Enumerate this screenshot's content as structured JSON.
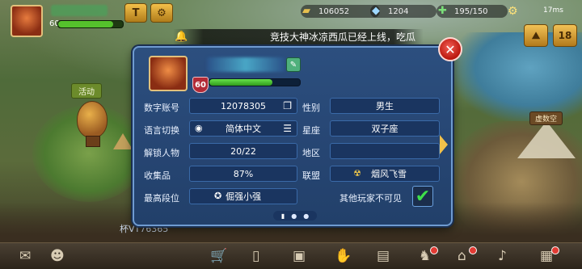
{
  "map": {
    "activity_banner": "活动",
    "location_banner": "虚数空",
    "player_tag": "杯VT76365"
  },
  "hud": {
    "level": "60",
    "exp_fraction": 0.85,
    "resources": [
      {
        "icon": "gold-bar-icon",
        "value": "106052"
      },
      {
        "icon": "gem-icon",
        "value": "1204"
      },
      {
        "icon": "stamina-icon",
        "value": "195/150"
      }
    ],
    "network": "17ms"
  },
  "announcement": {
    "text": "竞技大神冰凉西瓜已经上线，吃瓜"
  },
  "dialog": {
    "level": "60",
    "exp_fraction": 0.7,
    "close_label": "✕",
    "rows": {
      "account_label": "数字账号",
      "account_value": "12078305",
      "gender_label": "性别",
      "gender_value": "男生",
      "language_label": "语言切换",
      "language_value": "简体中文",
      "zodiac_label": "星座",
      "zodiac_value": "双子座",
      "unlock_label": "解锁人物",
      "unlock_value": "20/22",
      "region_label": "地区",
      "region_value": "",
      "collect_label": "收集品",
      "collect_value": "87%",
      "alliance_label": "联盟",
      "alliance_value": "烟风飞雪",
      "rank_label": "最高段位",
      "rank_value": "倔强小强",
      "privacy_label": "其他玩家不可见"
    }
  },
  "bottom_bar": {
    "icons": [
      "mail-icon",
      "character-icon",
      "shop-cart-icon",
      "phone-icon",
      "backpack-icon",
      "graduation-icon",
      "handshake-icon",
      "cards-icon",
      "rider-icon",
      "bank-icon",
      "music-icon",
      "store-icon"
    ]
  }
}
